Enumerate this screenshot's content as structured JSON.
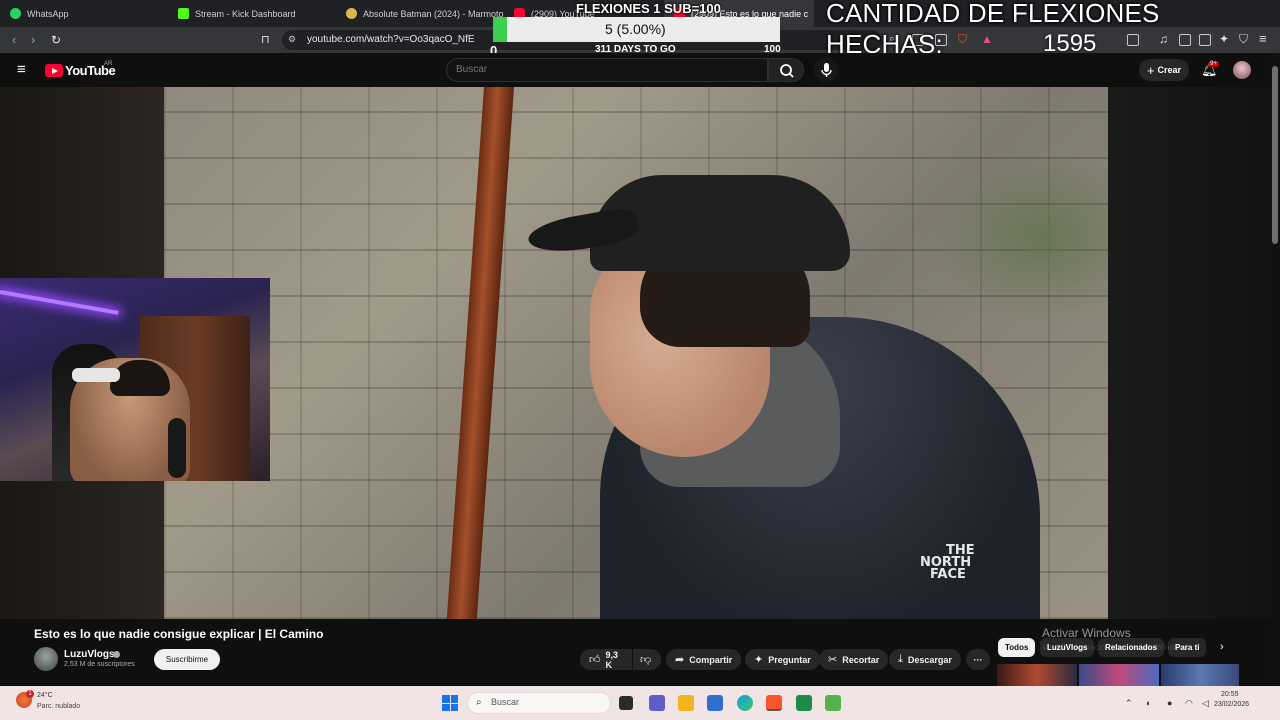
{
  "browser": {
    "tabs": [
      {
        "label": "WhatsApp",
        "color": "#25d366",
        "active": false
      },
      {
        "label": "Stream - Kick Dashboard",
        "color": "#53fc18",
        "active": false
      },
      {
        "label": "Absolute Batman (2024) - Marmoto",
        "color": "#d9b84a",
        "active": false
      },
      {
        "label": "(2909) YouTube",
        "color": "#ff0033",
        "active": false
      },
      {
        "label": "(2909) Esto es lo que nadie c",
        "color": "#ff0033",
        "active": true
      }
    ],
    "url": "youtube.com/watch?v=Oo3qacO_NfE"
  },
  "overlay": {
    "goal_title": "FLEXIONES 1 SUB=100",
    "goal_progress_text": "5 (5.00%)",
    "goal_fraction": 0.05,
    "goal_min": "0",
    "goal_days": "311 DAYS TO GO",
    "goal_max": "100",
    "counter_label": "CANTIDAD DE FLEXIONES HECHAS:",
    "counter_value": "1595"
  },
  "youtube": {
    "logo_text": "YouTube",
    "region": "AR",
    "search_placeholder": "Buscar",
    "create_label": "Crear",
    "notif_badge": "9+",
    "video_title": "Esto es lo que nadie consigue explicar | El Camino",
    "channel_name": "LuzuVlogs",
    "channel_subs": "2,53 M de suscriptores",
    "subscribe_label": "Suscribirme",
    "like_count": "9,3 K",
    "share_label": "Compartir",
    "ask_label": "Preguntar",
    "clip_label": "Recortar",
    "download_label": "Descargar",
    "more_label": "···",
    "chips": [
      {
        "label": "Todos",
        "selected": true
      },
      {
        "label": "LuzuVlogs",
        "selected": false
      },
      {
        "label": "Relacionados",
        "selected": false
      },
      {
        "label": "Para ti",
        "selected": false
      }
    ],
    "video_logo_lines": [
      "THE",
      "NORTH",
      "FACE"
    ]
  },
  "windows": {
    "activate_title": "Activar Windows",
    "activate_subtitle": "Ve a Configuración para activar Windows.",
    "weather_temp": "24°C",
    "weather_cond": "Parc. nublado",
    "weather_badge": "1",
    "search_placeholder": "Buscar",
    "time": "20:55",
    "date": "23/02/2026"
  }
}
